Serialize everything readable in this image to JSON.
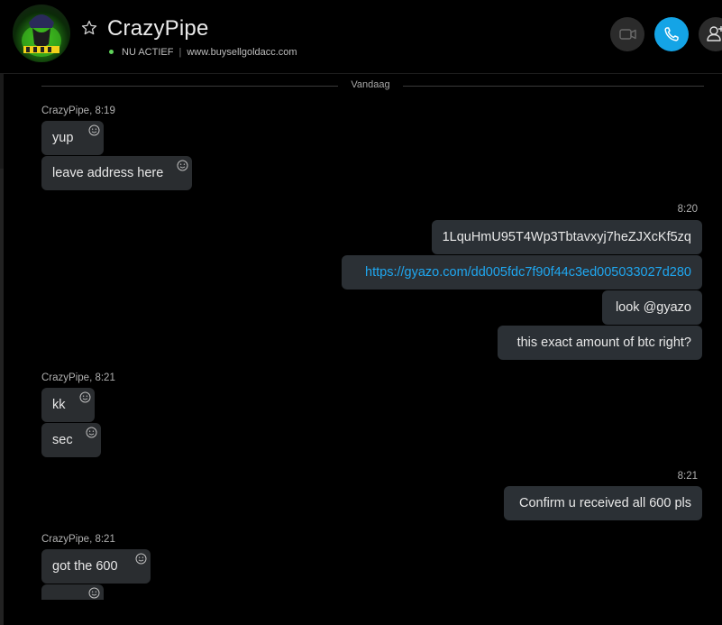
{
  "header": {
    "contact_name": "CrazyPipe",
    "status": "NU ACTIEF",
    "separator": "|",
    "mood": "www.buysellgoldacc.com"
  },
  "date_separator": "Vandaag",
  "messages": {
    "g1": {
      "sender": "CrazyPipe",
      "time": "8:19",
      "items": [
        "yup",
        "leave address here"
      ]
    },
    "g2": {
      "time": "8:20",
      "items": [
        "1LquHmU95T4Wp3Tbtavxyj7heZJXcKf5zq",
        "https://gyazo.com/dd005fdc7f90f44c3ed005033027d280",
        "look @gyazo",
        "this exact amount of btc right?"
      ]
    },
    "g3": {
      "sender": "CrazyPipe",
      "time": "8:21",
      "items": [
        "kk",
        "sec"
      ]
    },
    "g4": {
      "time": "8:21",
      "items": [
        "Confirm u received all 600 pls"
      ]
    },
    "g5": {
      "sender": "CrazyPipe",
      "time": "8:21",
      "items": [
        "got the 600",
        ""
      ]
    }
  },
  "colors": {
    "background": "#000000",
    "bubble": "#2a2d30",
    "call_button": "#14a4e6",
    "link": "#1fa7f0",
    "online": "#5fd35a"
  },
  "icons": [
    "star-icon",
    "video-call-icon",
    "phone-icon",
    "add-person-icon",
    "smiley-react-icon"
  ]
}
